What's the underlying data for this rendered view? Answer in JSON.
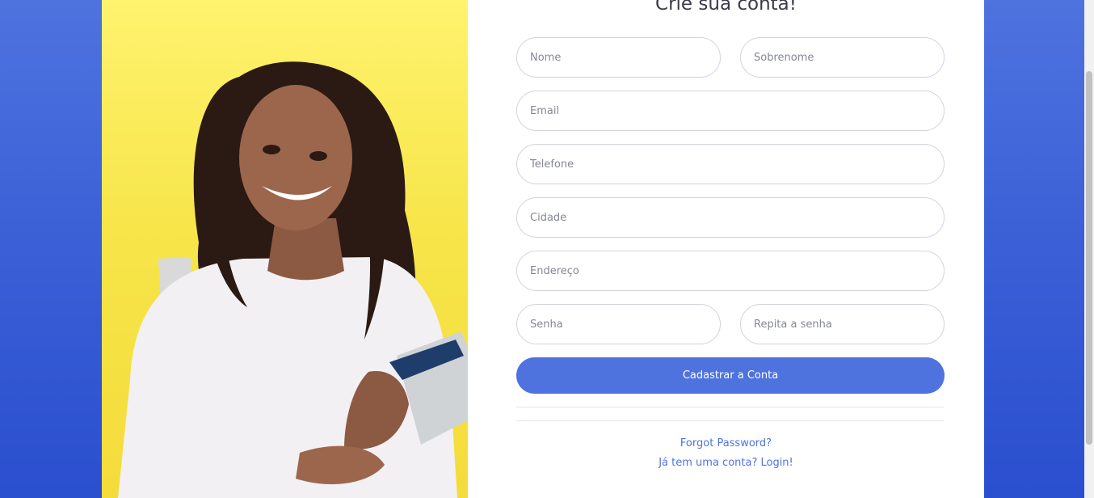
{
  "form": {
    "title": "Crie sua conta!",
    "fields": {
      "nome": "Nome",
      "sobrenome": "Sobrenome",
      "email": "Email",
      "telefone": "Telefone",
      "cidade": "Cidade",
      "endereco": "Endereço",
      "senha": "Senha",
      "repita_senha": "Repita a senha"
    },
    "submit_label": "Cadastrar a Conta",
    "forgot_link": "Forgot Password?",
    "login_link": "Já tem uma conta? Login!"
  },
  "colors": {
    "accent": "#4e73df",
    "background": "#3a5fd6",
    "photo_background": "#f7e54a"
  },
  "icons": {
    "hero": "student-photo"
  }
}
